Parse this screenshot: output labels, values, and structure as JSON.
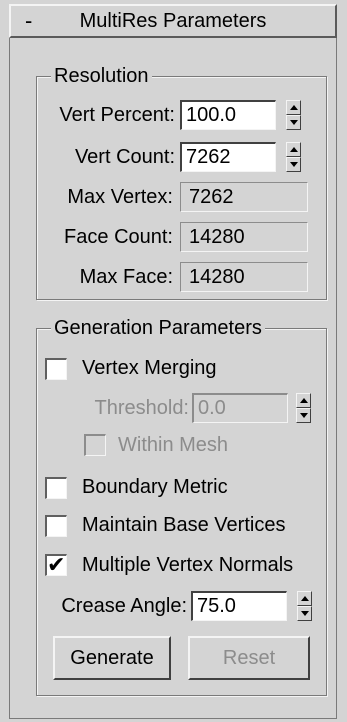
{
  "rollout": {
    "toggle": "-",
    "title": "MultiRes Parameters"
  },
  "resolution": {
    "group_label": "Resolution",
    "vert_percent": {
      "label": "Vert Percent:",
      "value": "100.0"
    },
    "vert_count": {
      "label": "Vert Count:",
      "value": "7262"
    },
    "max_vertex": {
      "label": "Max Vertex:",
      "value": "7262"
    },
    "face_count": {
      "label": "Face Count:",
      "value": "14280"
    },
    "max_face": {
      "label": "Max Face:",
      "value": "14280"
    }
  },
  "generation": {
    "group_label": "Generation Parameters",
    "vertex_merging": {
      "label": "Vertex Merging",
      "checked": false
    },
    "threshold": {
      "label": "Threshold:",
      "value": "0.0"
    },
    "within_mesh": {
      "label": "Within Mesh",
      "checked": false
    },
    "boundary_metric": {
      "label": "Boundary Metric",
      "checked": false
    },
    "maintain_base_vertices": {
      "label": "Maintain Base Vertices",
      "checked": false
    },
    "multiple_vertex_normals": {
      "label": "Multiple Vertex Normals",
      "checked": true,
      "mark": "✔"
    },
    "crease_angle": {
      "label": "Crease Angle:",
      "value": "75.0"
    },
    "generate_label": "Generate",
    "reset_label": "Reset"
  }
}
